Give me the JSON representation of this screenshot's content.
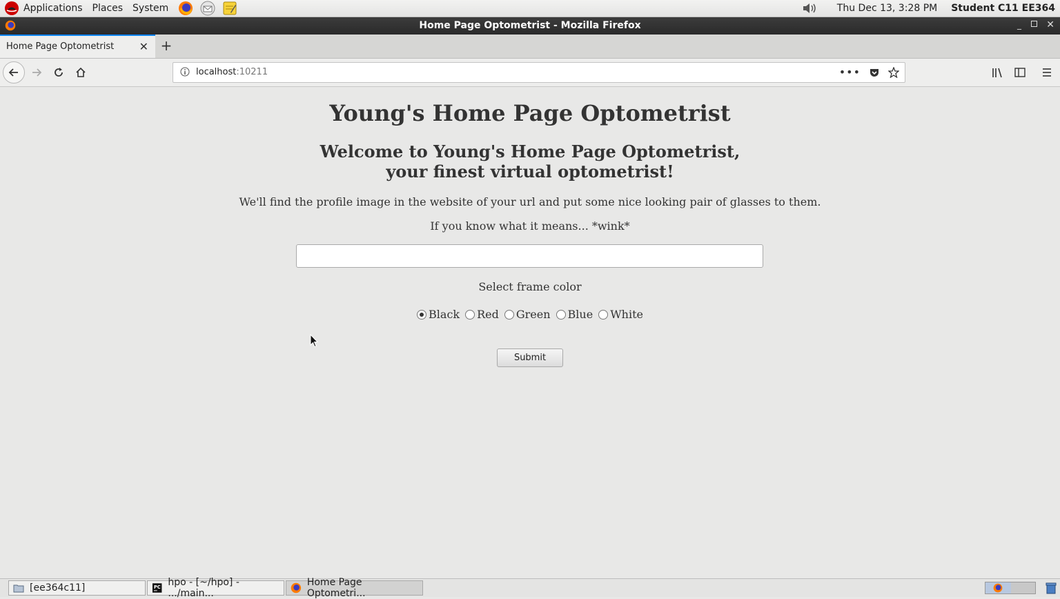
{
  "topbar": {
    "menus": [
      "Applications",
      "Places",
      "System"
    ],
    "clock": "Thu Dec 13,  3:28 PM",
    "user": "Student C11 EE364",
    "icons": [
      "redhat-icon",
      "firefox-launcher-icon",
      "mail-launcher-icon",
      "notes-launcher-icon",
      "volume-icon"
    ]
  },
  "window": {
    "title": "Home Page Optometrist - Mozilla Firefox"
  },
  "browser": {
    "tab_title": "Home Page Optometrist",
    "url_host": "localhost",
    "url_port": ":10211"
  },
  "page": {
    "heading": "Young's Home Page Optometrist",
    "welcome_line1": "Welcome to Young's Home Page Optometrist,",
    "welcome_line2": "your finest virtual optometrist!",
    "description": "We'll find the profile image in the website of your url and put some nice looking pair of glasses to them.",
    "wink": "If you know what it means... *wink*",
    "url_input_value": "",
    "select_label": "Select frame color",
    "colors": [
      {
        "label": "Black",
        "checked": true
      },
      {
        "label": "Red",
        "checked": false
      },
      {
        "label": "Green",
        "checked": false
      },
      {
        "label": "Blue",
        "checked": false
      },
      {
        "label": "White",
        "checked": false
      }
    ],
    "submit_label": "Submit"
  },
  "taskbar": {
    "items": [
      {
        "label": "[ee364c11]",
        "icon": "folder-icon",
        "active": false
      },
      {
        "label": "hpo - [~/hpo] - .../main...",
        "icon": "pycharm-icon",
        "active": false
      },
      {
        "label": "Home Page Optometri...",
        "icon": "firefox-icon",
        "active": true
      }
    ]
  }
}
